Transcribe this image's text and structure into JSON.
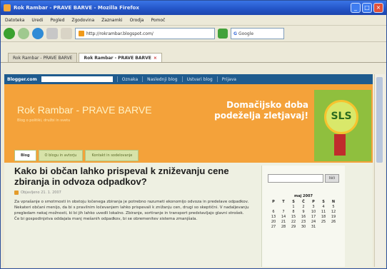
{
  "window": {
    "title": "Rok Rambar - PRAVE BARVE - Mozilla Firefox"
  },
  "menu": [
    "Datoteka",
    "Uredi",
    "Pogled",
    "Zgodovina",
    "Zaznamki",
    "Orodja",
    "Pomoč"
  ],
  "address": {
    "url": "http://rokrambar.blogspot.com/"
  },
  "search": {
    "engine": "G",
    "placeholder": "Google"
  },
  "tabs": [
    {
      "label": "Rok Rambar - PRAVE BARVE",
      "active": false
    },
    {
      "label": "Rok Rambar - PRAVE BARVE",
      "active": true
    }
  ],
  "site_nav": {
    "logo": "Blogger.com",
    "links": [
      "Oznaka",
      "Naslednji blog",
      "Ustvari blog",
      "Prijava"
    ]
  },
  "banner": {
    "title": "Rok Rambar - PRAVE BARVE",
    "subtitle": "Blog o politiki, družbi in svetu",
    "ad_line1": "Domačijsko doba",
    "ad_line2": "podeželja zletjavaj!",
    "logo_text": "SLS"
  },
  "page_tabs": [
    "Blog",
    "O blogu in avtorju",
    "Kontakt in sodelovanje"
  ],
  "post": {
    "title": "Kako bi občan lahko prispeval k zniževanju cene zbiranja in odvoza odpadkov?",
    "meta": "Objavljeno 21. 1. 2007",
    "body": "Za vprašanje o smotrnosti in obstoju ločenega zbiranja je potrebno razumeti ekonomijo odvoza in predelave odpadkov. Nekateri občani menijo, da bi s pravilnim ločevanjem lahko prispevali k znižanju cen, drugi so skeptični. V nadaljevanju pregledam nekaj možnosti, ki bi jih lahko uvedli lokalno. Zbiranje, sortiranje in transport predstavljajo glavni strošek. Če bi gospodinjstva oddajala manj mešanih odpadkov, bi se obremenitev sistema zmanjšala."
  },
  "sidebar": {
    "search_button": "Išči",
    "calendar": {
      "month": "maj 2007",
      "headers": [
        "P",
        "T",
        "S",
        "Č",
        "P",
        "S",
        "N"
      ],
      "rows": [
        [
          "",
          "",
          "1",
          "2",
          "3",
          "4",
          "5"
        ],
        [
          "6",
          "7",
          "8",
          "9",
          "10",
          "11",
          "12"
        ],
        [
          "13",
          "14",
          "15",
          "16",
          "17",
          "18",
          "19"
        ],
        [
          "20",
          "21",
          "22",
          "23",
          "24",
          "25",
          "26"
        ],
        [
          "27",
          "28",
          "29",
          "30",
          "31",
          "",
          ""
        ]
      ]
    }
  }
}
